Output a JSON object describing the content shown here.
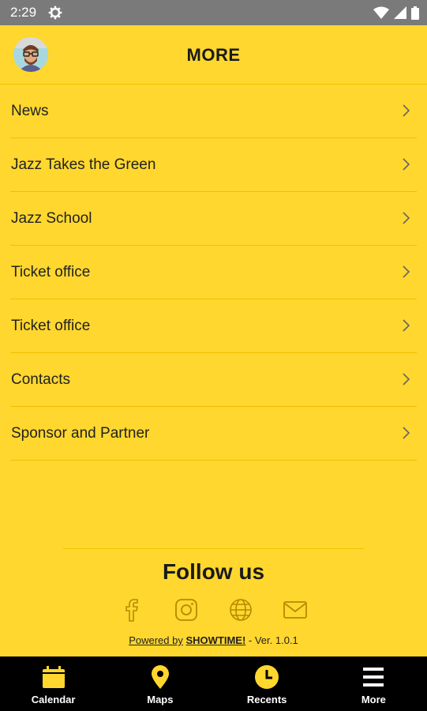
{
  "status_bar": {
    "time": "2:29"
  },
  "header": {
    "title": "MORE"
  },
  "menu": {
    "items": [
      {
        "label": "News"
      },
      {
        "label": "Jazz Takes the Green"
      },
      {
        "label": "Jazz School"
      },
      {
        "label": "Ticket office"
      },
      {
        "label": "Ticket office"
      },
      {
        "label": "Contacts"
      },
      {
        "label": "Sponsor and Partner"
      }
    ]
  },
  "follow": {
    "title": "Follow us",
    "icons": [
      "facebook-icon",
      "instagram-icon",
      "globe-icon",
      "mail-icon"
    ]
  },
  "powered": {
    "prefix": "Powered by",
    "brand": "SHOWTIME!",
    "suffix": " - Ver. 1.0.1"
  },
  "bottom_nav": {
    "items": [
      {
        "label": "Calendar",
        "icon": "calendar-icon"
      },
      {
        "label": "Maps",
        "icon": "map-pin-icon"
      },
      {
        "label": "Recents",
        "icon": "clock-icon"
      },
      {
        "label": "More",
        "icon": "menu-icon"
      }
    ]
  },
  "colors": {
    "background": "#FFD72E",
    "nav": "#000000",
    "accent": "#FFD72E"
  }
}
